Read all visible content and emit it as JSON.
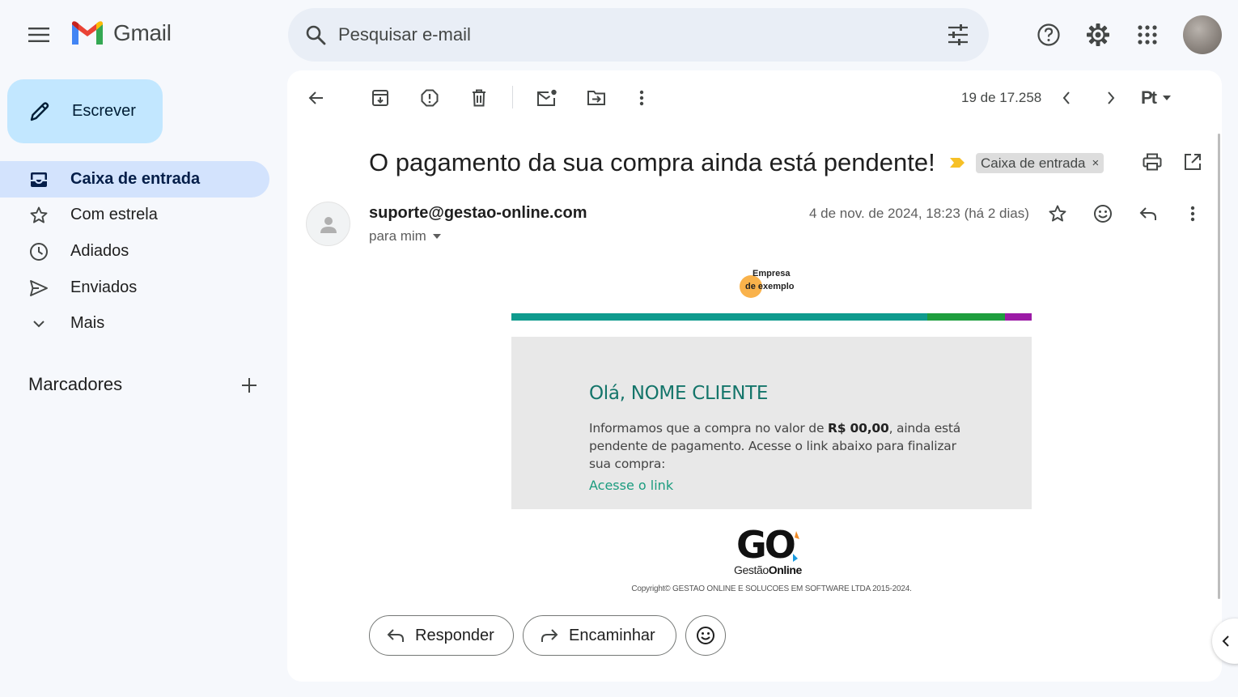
{
  "app": {
    "name": "Gmail",
    "accent": "#c2e7ff",
    "active_nav_color": "#d3e3fd"
  },
  "search": {
    "placeholder": "Pesquisar e-mail"
  },
  "icons": {
    "menu": "hamburger-menu-icon",
    "search": "search-icon",
    "tune": "search-options-icon",
    "help": "help-icon",
    "settings": "gear-icon",
    "apps": "apps-grid-icon"
  },
  "sidebar": {
    "compose_label": "Escrever",
    "items": [
      {
        "label": "Caixa de entrada",
        "icon": "inbox-icon",
        "active": true
      },
      {
        "label": "Com estrela",
        "icon": "star-icon",
        "active": false
      },
      {
        "label": "Adiados",
        "icon": "clock-icon",
        "active": false
      },
      {
        "label": "Enviados",
        "icon": "send-icon",
        "active": false
      },
      {
        "label": "Mais",
        "icon": "chevron-down-icon",
        "active": false
      }
    ],
    "labels_heading": "Marcadores"
  },
  "toolbar": {
    "page_count": "19 de 17.258",
    "input_tool": "Pt"
  },
  "email": {
    "subject": "O pagamento da sua compra ainda está pendente!",
    "label_chip": "Caixa de entrada",
    "label_chip_close": "×",
    "sender": "suporte@gestao-online.com",
    "to": "para mim",
    "date": "4 de nov. de 2024, 18:23 (há 2 dias)"
  },
  "email_body": {
    "company_logo_line1": "Empresa",
    "company_logo_line2": "de exemplo",
    "bar_colors": [
      "#0f9b8e",
      "#1e9e3e",
      "#9c1ba6"
    ],
    "greeting": "Olá, NOME CLIENTE",
    "message_pre": "Informamos que a compra no valor de ",
    "message_amount": "R$ 00,00",
    "message_post": ", ainda está pendente de pagamento. Acesse o link abaixo para finalizar sua compra:",
    "link_text": "Acesse o link",
    "footer_logo": "GO",
    "footer_brand_1": "Gestão",
    "footer_brand_2": "Online",
    "copyright": "Copyright© GESTAO ONLINE E SOLUCOES EM SOFTWARE LTDA 2015-2024."
  },
  "actions": {
    "reply_label": "Responder",
    "forward_label": "Encaminhar"
  }
}
